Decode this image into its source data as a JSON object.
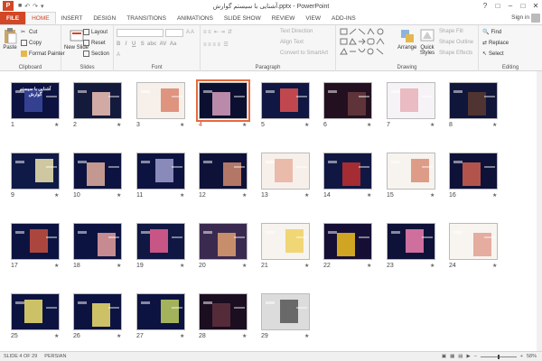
{
  "window": {
    "title": "ﺁﺷﻨﺎﯾﯽ ﺑﺎ ﺳﯿﺴﺘﻢ ﮔﻮﺍﺭﺵ.pptx - PowerPoint",
    "app_logo": "P"
  },
  "tabs": [
    {
      "label": "FILE"
    },
    {
      "label": "HOME"
    },
    {
      "label": "INSERT"
    },
    {
      "label": "DESIGN"
    },
    {
      "label": "TRANSITIONS"
    },
    {
      "label": "ANIMATIONS"
    },
    {
      "label": "SLIDE SHOW"
    },
    {
      "label": "REVIEW"
    },
    {
      "label": "VIEW"
    },
    {
      "label": "ADD-INS"
    }
  ],
  "signin": "Sign in",
  "ribbon": {
    "clipboard": {
      "label": "Clipboard",
      "paste": "Paste",
      "cut": "Cut",
      "copy": "Copy",
      "format_painter": "Format Painter"
    },
    "slides": {
      "label": "Slides",
      "new_slide": "New Slide",
      "layout": "Layout",
      "reset": "Reset",
      "section": "Section"
    },
    "font": {
      "label": "Font"
    },
    "paragraph": {
      "label": "Paragraph",
      "text_direction": "Text Direction",
      "align_text": "Align Text",
      "smartart": "Convert to SmartArt"
    },
    "drawing": {
      "label": "Drawing",
      "arrange": "Arrange",
      "quick_styles": "Quick Styles",
      "shape_fill": "Shape Fill",
      "shape_outline": "Shape Outline",
      "shape_effects": "Shape Effects"
    },
    "editing": {
      "label": "Editing",
      "find": "Find",
      "replace": "Replace",
      "select": "Select"
    }
  },
  "slides": [
    {
      "num": "1",
      "title": "ﺁﺷﻨﺎﯾﯽ ﺑﺎ ﺳﯿﺴﺘﻢ ﮔﻮﺍﺭﺵ"
    },
    {
      "num": "2"
    },
    {
      "num": "3"
    },
    {
      "num": "4"
    },
    {
      "num": "5"
    },
    {
      "num": "6"
    },
    {
      "num": "7"
    },
    {
      "num": "8"
    },
    {
      "num": "9"
    },
    {
      "num": "10"
    },
    {
      "num": "11"
    },
    {
      "num": "12"
    },
    {
      "num": "13"
    },
    {
      "num": "14"
    },
    {
      "num": "15"
    },
    {
      "num": "16"
    },
    {
      "num": "17"
    },
    {
      "num": "18"
    },
    {
      "num": "19"
    },
    {
      "num": "20"
    },
    {
      "num": "21"
    },
    {
      "num": "22"
    },
    {
      "num": "23"
    },
    {
      "num": "24"
    },
    {
      "num": "25"
    },
    {
      "num": "26"
    },
    {
      "num": "27"
    },
    {
      "num": "28"
    },
    {
      "num": "29"
    }
  ],
  "selected_slide": "4",
  "status": {
    "slide_info": "SLIDE 4 OF 29",
    "language": "PERSIAN",
    "zoom": "58%"
  }
}
